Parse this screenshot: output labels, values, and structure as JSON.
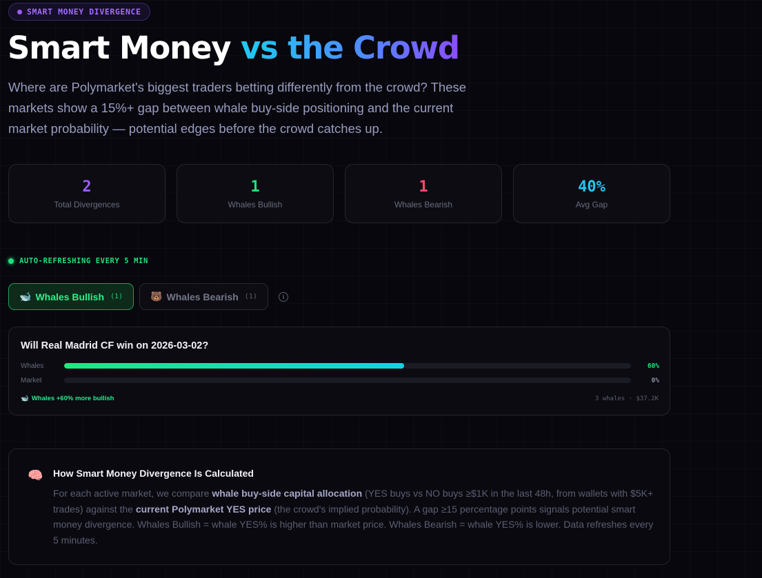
{
  "badge": {
    "label": "SMART MONEY DIVERGENCE"
  },
  "header": {
    "title_plain": "Smart Money ",
    "title_accent": "vs the Crowd",
    "subtitle": "Where are Polymarket's biggest traders betting differently from the crowd? These markets show a 15%+ gap between whale buy-side positioning and the current market probability — potential edges before the crowd catches up."
  },
  "stats": [
    {
      "value": "2",
      "label": "Total Divergences",
      "color": "#9b5cff"
    },
    {
      "value": "1",
      "label": "Whales Bullish",
      "color": "#23e07a"
    },
    {
      "value": "1",
      "label": "Whales Bearish",
      "color": "#ff4d6d"
    },
    {
      "value": "40%",
      "label": "Avg Gap",
      "color": "#22c7ef"
    }
  ],
  "status": {
    "auto_refresh": "AUTO-REFRESHING EVERY 5 MIN"
  },
  "tabs": [
    {
      "icon": "whale-icon",
      "emoji": "🐋",
      "label": "Whales Bullish",
      "count": "(1)",
      "active": true
    },
    {
      "icon": "bear-icon",
      "emoji": "🐻",
      "label": "Whales Bearish",
      "count": "(1)",
      "active": false
    }
  ],
  "market_card": {
    "question": "Will Real Madrid CF win on 2026-03-02?",
    "whales_label": "Whales",
    "whales_pct_text": "60%",
    "whales_value": 0.6,
    "market_label": "Market",
    "market_pct_text": "0%",
    "market_value": 0.0,
    "signal_icon": "🐋",
    "signal_text": "Whales +60% more bullish",
    "meta": "3 whales · $37.2K",
    "colors": {
      "whales_pct": "#23e07a",
      "market_pct": "#8a8ca0"
    }
  },
  "how": {
    "icon": "🧠",
    "title": "How Smart Money Divergence Is Calculated",
    "p1": "For each active market, we compare ",
    "b1": "whale buy-side capital allocation",
    "p2": " (YES buys vs NO buys ≥$1K in the last 48h, from wallets with $5K+ trades) against the ",
    "b2": "current Polymarket YES price",
    "p3": " (the crowd's implied probability). A gap ≥15 percentage points signals potential smart money divergence. Whales Bullish = whale YES% is higher than market price. Whales Bearish = whale YES% is lower. Data refreshes every 5 minutes."
  }
}
